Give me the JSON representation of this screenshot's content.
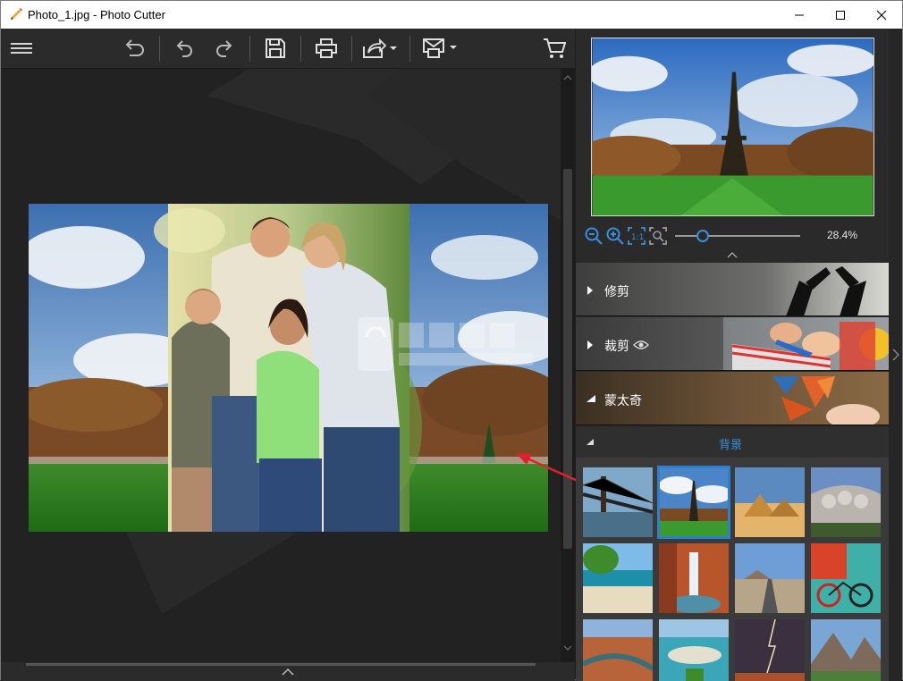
{
  "window": {
    "title": "Photo_1.jpg - Photo Cutter",
    "minimize_icon": "minimize-icon",
    "maximize_icon": "maximize-icon",
    "close_icon": "close-icon"
  },
  "toolbar": {
    "items": [
      "menu-icon",
      "undo-all-icon",
      "undo-icon",
      "redo-icon",
      "save-icon",
      "print-icon",
      "share-icon",
      "send-icon",
      "cart-icon"
    ]
  },
  "preview": {
    "zoom_value": "28.4%",
    "zoom_level": 0.22,
    "zoom_icons": [
      "zoom-out-icon",
      "zoom-in-icon",
      "actual-size-icon",
      "fit-icon"
    ]
  },
  "sections": [
    {
      "label": "修剪",
      "expanded": false
    },
    {
      "label": "裁剪",
      "expanded": false,
      "has_eye": true
    },
    {
      "label": "蒙太奇",
      "expanded": true
    }
  ],
  "background_panel": {
    "label": "背景",
    "thumbnails": [
      "bridge",
      "eiffel-tower",
      "pyramids",
      "mount-rushmore",
      "beach",
      "waterfall",
      "desert-road",
      "bicycle-wall",
      "canyon",
      "island-resort",
      "lightning-desert",
      "mountain-valley"
    ],
    "selected_index": 1
  },
  "colors": {
    "accent": "#2d7fd0",
    "toolbar_bg": "#2b2b2b",
    "panel_bg": "#2a2a2a",
    "annotation_arrow": "#e0202a"
  }
}
